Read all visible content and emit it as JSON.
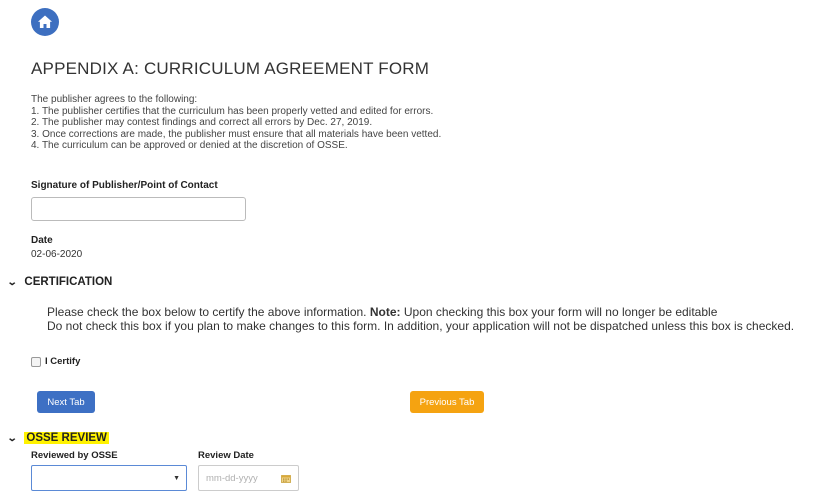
{
  "header": {
    "home_icon": "home-icon",
    "title": "APPENDIX A: CURRICULUM AGREEMENT FORM"
  },
  "agreement": {
    "intro": "The publisher agrees to the following:",
    "items": [
      "1. The publisher certifies that the curriculum has been properly vetted and edited for errors.",
      "2. The publisher may contest findings and correct all errors by Dec. 27, 2019.",
      "3. Once corrections are made, the publisher must ensure that all materials have been vetted.",
      "4. The curriculum can be approved or denied at the discretion of OSSE."
    ]
  },
  "signature": {
    "label": "Signature of Publisher/Point of Contact",
    "value": ""
  },
  "date": {
    "label": "Date",
    "value": "02-06-2020"
  },
  "certification": {
    "heading": "CERTIFICATION",
    "line1_prefix": "Please check the box below to certify the above information. ",
    "line1_note": "Note:",
    "line1_suffix": " Upon checking this box your form will no longer be editable",
    "line2": "Do not check this box if you plan to make changes to this form. In addition, your application will not be dispatched unless this box is checked.",
    "checkbox_label": "I Certify",
    "checked": false
  },
  "buttons": {
    "next": "Next Tab",
    "previous": "Previous Tab"
  },
  "osse_review": {
    "heading": "OSSE REVIEW",
    "reviewed_by_label": "Reviewed by OSSE",
    "reviewed_by_value": "",
    "review_date_label": "Review Date",
    "review_date_placeholder": "mm-dd-yyyy",
    "calendar_icon": "calendar-icon"
  },
  "colors": {
    "primary": "#3d70c4",
    "warning": "#f5a311",
    "highlight": "#fff200"
  }
}
